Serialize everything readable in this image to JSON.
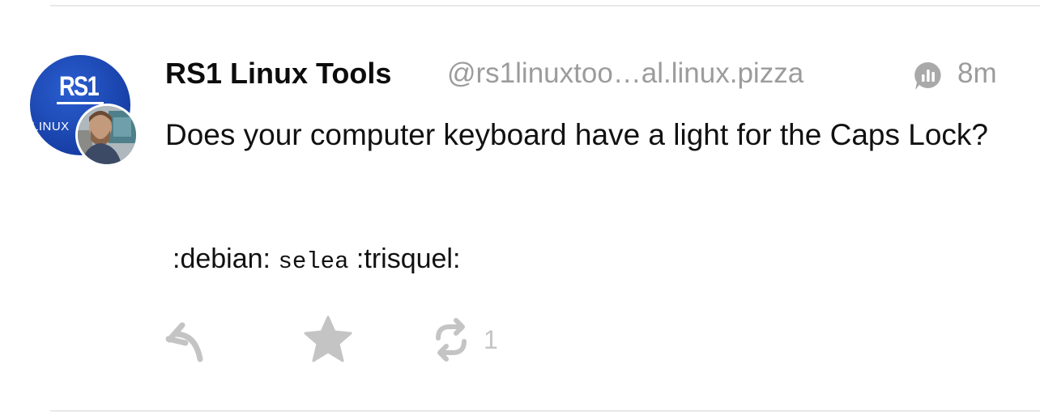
{
  "post": {
    "author": {
      "display_name": "RS1 Linux Tools",
      "handle": "@rs1linuxtoo…al.linux.pizza",
      "avatar_text": "RS1",
      "avatar_subtext": "LINUX"
    },
    "visibility_icon": "chart-bubble-icon",
    "timestamp": "8m",
    "content": "Does your computer keyboard have a light for the Caps Lock?",
    "emoji_line": {
      "part1": ":debian:",
      "part2": "selea",
      "part3": ":trisquel:"
    },
    "actions": {
      "reply_icon": "reply-icon",
      "favourite_icon": "star-icon",
      "boost_icon": "boost-icon",
      "boost_count": "1"
    }
  },
  "colors": {
    "text": "#111111",
    "muted": "#9c9c9c",
    "action_gray": "#c4c4c4",
    "avatar_blue": "#1a44b0",
    "divider": "#e8e8e8"
  }
}
